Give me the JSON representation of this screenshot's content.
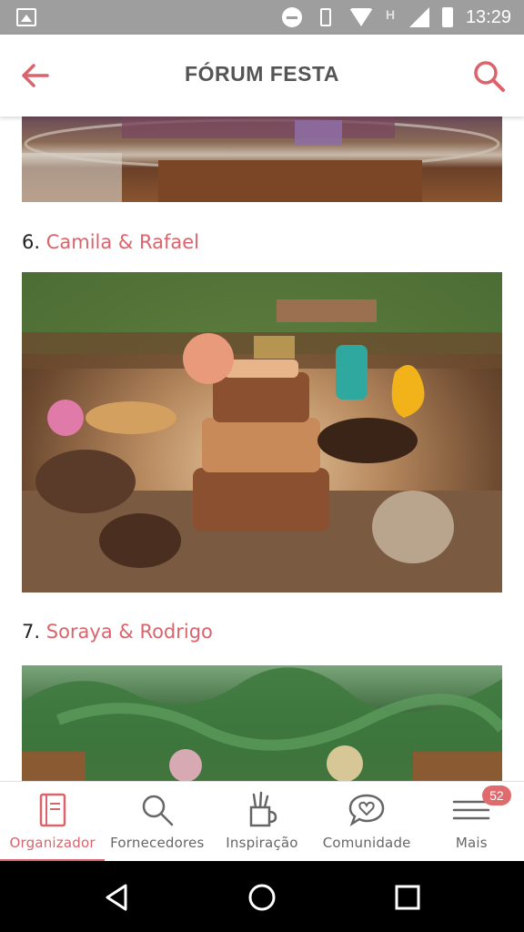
{
  "status_bar": {
    "time": "13:29",
    "network_label": "H",
    "icons": [
      "image-icon",
      "dnd-icon",
      "vibrate-icon",
      "wifi-icon",
      "signal-icon",
      "battery-icon"
    ]
  },
  "app_bar": {
    "title": "FÓRUM FESTA",
    "back_icon": "back-arrow-icon",
    "search_icon": "search-icon"
  },
  "sections": [
    {
      "number": "6.",
      "name": "Camila & Rafael"
    },
    {
      "number": "7.",
      "name": "Soraya & Rodrigo"
    }
  ],
  "bottom_nav": {
    "items": [
      {
        "label": "Organizador",
        "icon": "notebook-icon",
        "active": true
      },
      {
        "label": "Fornecedores",
        "icon": "search-icon",
        "active": false
      },
      {
        "label": "Inspiração",
        "icon": "brush-cup-icon",
        "active": false
      },
      {
        "label": "Comunidade",
        "icon": "heart-chat-icon",
        "active": false
      },
      {
        "label": "Mais",
        "icon": "menu-icon",
        "active": false,
        "badge": "52"
      }
    ]
  },
  "colors": {
    "accent": "#d9646c",
    "status_bar": "#9e9e9e",
    "android_nav": "#000000"
  }
}
